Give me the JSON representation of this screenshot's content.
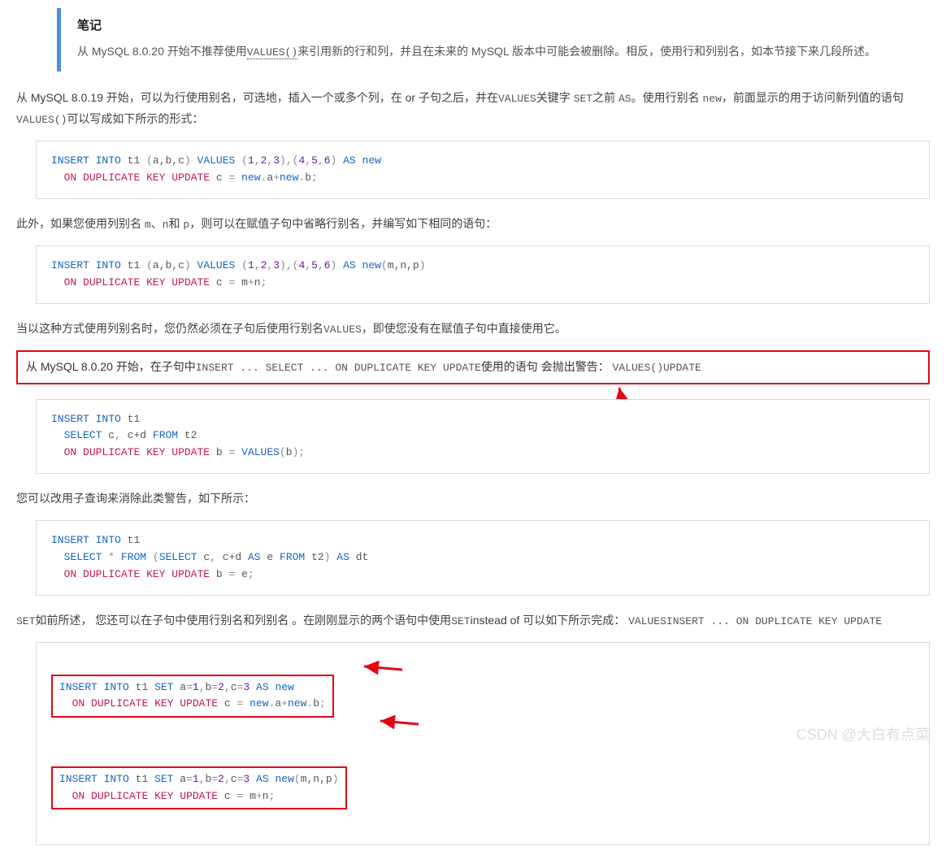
{
  "note": {
    "title": "笔记",
    "body_prefix": "从 MySQL 8.0.20 开始不推荐使用",
    "values_fn": "VALUES()",
    "body_suffix": "来引用新的行和列，并且在未来的 MySQL 版本中可能会被删除。相反，使用行和列别名，如本节接下来几段所述。"
  },
  "para1": {
    "t1": "从 MySQL 8.0.19 开始，可以为行使用别名，可选地，插入一个或多个列，在 or 子句之后，并在",
    "c1": "VALUES",
    "t2": "关键字 ",
    "c2": "SET",
    "t3": "之前 ",
    "c3": "AS",
    "t4": "。使用行别名 ",
    "c4": "new",
    "t5": "，前面显示的用于访问新列值的语句",
    "c5": "VALUES()",
    "t6": "可以写成如下所示的形式："
  },
  "code1": {
    "line1": {
      "insert": "INSERT",
      "into": "INTO",
      "tbl": "t1",
      "cols": "a,b,c",
      "values": "VALUES",
      "v1": "1",
      "v2": "2",
      "v3": "3",
      "v4": "4",
      "v5": "5",
      "v6": "6",
      "as": "AS",
      "alias": "new"
    },
    "line2": {
      "on": "ON",
      "dup": "DUPLICATE",
      "key": "KEY",
      "upd": "UPDATE",
      "col": "c",
      "eq": "=",
      "expr_a": "new",
      "dot1": ".",
      "a": "a",
      "plus": "+",
      "expr_b": "new",
      "dot2": ".",
      "b": "b"
    }
  },
  "para2": {
    "t1": "此外，如果您使用列别名 ",
    "c1": "m",
    "t2": "、",
    "c2": "n",
    "t3": "和 ",
    "c3": "p",
    "t4": "，则可以在赋值子句中省略行别名，并编写如下相同的语句："
  },
  "code2": {
    "line1": {
      "insert": "INSERT",
      "into": "INTO",
      "tbl": "t1",
      "cols": "a,b,c",
      "values": "VALUES",
      "v1": "1",
      "v2": "2",
      "v3": "3",
      "v4": "4",
      "v5": "5",
      "v6": "6",
      "as": "AS",
      "alias": "new",
      "pcols": "m,n,p"
    },
    "line2": {
      "on": "ON",
      "dup": "DUPLICATE",
      "key": "KEY",
      "upd": "UPDATE",
      "col": "c",
      "eq": "=",
      "m": "m",
      "plus": "+",
      "n": "n"
    }
  },
  "para3": {
    "t1": "当以这种方式使用列别名时，您仍然必须在子句后使用行别名",
    "c1": "VALUES",
    "t2": "，即使您没有在赋值子句中直接使用它。"
  },
  "highlight": {
    "t1": "从 MySQL 8.0.20 开始，在子句中",
    "c1": "INSERT ... SELECT ... ON DUPLICATE KEY UPDATE",
    "t2": "使用的语句 会抛出警告： ",
    "c2": "VALUES()UPDATE"
  },
  "code3": {
    "line1": {
      "insert": "INSERT",
      "into": "INTO",
      "tbl": "t1"
    },
    "line2": {
      "select": "SELECT",
      "c": "c",
      "cd": "c+d",
      "from": "FROM",
      "t2": "t2"
    },
    "line3": {
      "on": "ON",
      "dup": "DUPLICATE",
      "key": "KEY",
      "upd": "UPDATE",
      "b": "b",
      "eq": "=",
      "values": "VALUES",
      "arg": "b"
    }
  },
  "para4": "您可以改用子查询来消除此类警告，如下所示：",
  "code4": {
    "line1": {
      "insert": "INSERT",
      "into": "INTO",
      "tbl": "t1"
    },
    "line2": {
      "select": "SELECT",
      "star": "*",
      "from": "FROM",
      "select2": "SELECT",
      "c": "c",
      "cd": "c+d",
      "as": "AS",
      "e": "e",
      "from2": "FROM",
      "t2": "t2",
      "as2": "AS",
      "dt": "dt"
    },
    "line3": {
      "on": "ON",
      "dup": "DUPLICATE",
      "key": "KEY",
      "upd": "UPDATE",
      "b": "b",
      "eq": "=",
      "e": "e"
    }
  },
  "para5": {
    "c0": "SET",
    "t1": "如前所述， 您还可以在子句中使用行别名和列别名 。在刚刚显示的两个语句中使用",
    "c1": "SET",
    "t2": "instead of 可以如下所示完成： ",
    "c2": "VALUESINSERT ... ON DUPLICATE KEY UPDATE"
  },
  "code5a": {
    "line1": {
      "insert": "INSERT",
      "into": "INTO",
      "tbl": "t1",
      "set": "SET",
      "a": "a",
      "eq1": "=",
      "v1": "1",
      "b": "b",
      "eq2": "=",
      "v2": "2",
      "c": "c",
      "eq3": "=",
      "v3": "3",
      "as": "AS",
      "alias": "new"
    },
    "line2": {
      "on": "ON",
      "dup": "DUPLICATE",
      "key": "KEY",
      "upd": "UPDATE",
      "col": "c",
      "eq": "=",
      "na": "new",
      "dot1": ".",
      "aa": "a",
      "plus": "+",
      "nb": "new",
      "dot2": ".",
      "bb": "b"
    }
  },
  "code5b": {
    "line1": {
      "insert": "INSERT",
      "into": "INTO",
      "tbl": "t1",
      "set": "SET",
      "a": "a",
      "eq1": "=",
      "v1": "1",
      "b": "b",
      "eq2": "=",
      "v2": "2",
      "c": "c",
      "eq3": "=",
      "v3": "3",
      "as": "AS",
      "alias": "new",
      "pcols": "m,n,p"
    },
    "line2": {
      "on": "ON",
      "dup": "DUPLICATE",
      "key": "KEY",
      "upd": "UPDATE",
      "col": "c",
      "eq": "=",
      "m": "m",
      "plus": "+",
      "n": "n"
    }
  },
  "watermark": "CSDN @大白有点菜"
}
